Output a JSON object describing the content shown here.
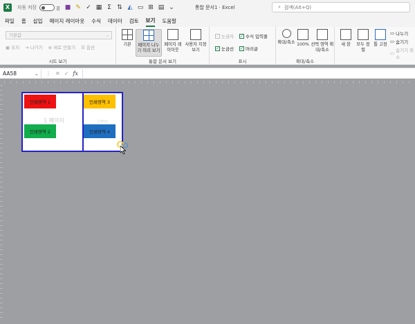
{
  "titlebar": {
    "autosave_label": "자동 저장",
    "autosave_state": "끔",
    "doc_title": "통합 문서1  ·  Excel",
    "search_placeholder": "검색(Alt+Q)"
  },
  "menu": {
    "tabs": [
      "파일",
      "홈",
      "삽입",
      "페이지 레이아웃",
      "수식",
      "데이터",
      "검토",
      "보기",
      "도움말"
    ],
    "active_tab": "보기"
  },
  "ribbon": {
    "sheet_view": {
      "dropdown_value": "기본값",
      "keep": "유지",
      "exit": "나가기",
      "new": "새로 만들기",
      "options": "옵션",
      "label": "시트 보기"
    },
    "workbook_views": {
      "normal": "기본",
      "page_break_preview": "페이지 나누기 미리 보기",
      "page_layout": "페이지 레이아웃",
      "custom_views": "사용자 지정 보기",
      "label": "통합 문서 보기"
    },
    "show": {
      "ruler": "눈금자",
      "formula_bar": "수식 입력줄",
      "gridlines": "눈금선",
      "headings": "머리글",
      "label": "표시"
    },
    "zoom": {
      "zoom": "확대/축소",
      "hundred": "100%",
      "zoom_to_selection": "선택 영역 확대/축소",
      "label": "확대/축소"
    },
    "window": {
      "new_window": "새 창",
      "arrange_all": "모두 정렬",
      "freeze_panes": "틀 고정",
      "split": "나누기",
      "hide": "숨기기",
      "unhide": "숨기기 취소"
    }
  },
  "formula_bar": {
    "name_box": "AA58",
    "fx": "fx",
    "cancel": "✕",
    "enter": "✓",
    "value": ""
  },
  "sheet": {
    "print_areas": [
      "인쇄영역 1",
      "인쇄영역 2",
      "인쇄영역 3",
      "인쇄영역 4"
    ],
    "watermark_page1": "1 페이지",
    "watermark_page2": "2 페이지",
    "colors": {
      "area1": "#ee1212",
      "area2": "#12ad4c",
      "area3": "#ffc000",
      "area4": "#1f6fc1",
      "page_break": "#2222c6"
    }
  }
}
